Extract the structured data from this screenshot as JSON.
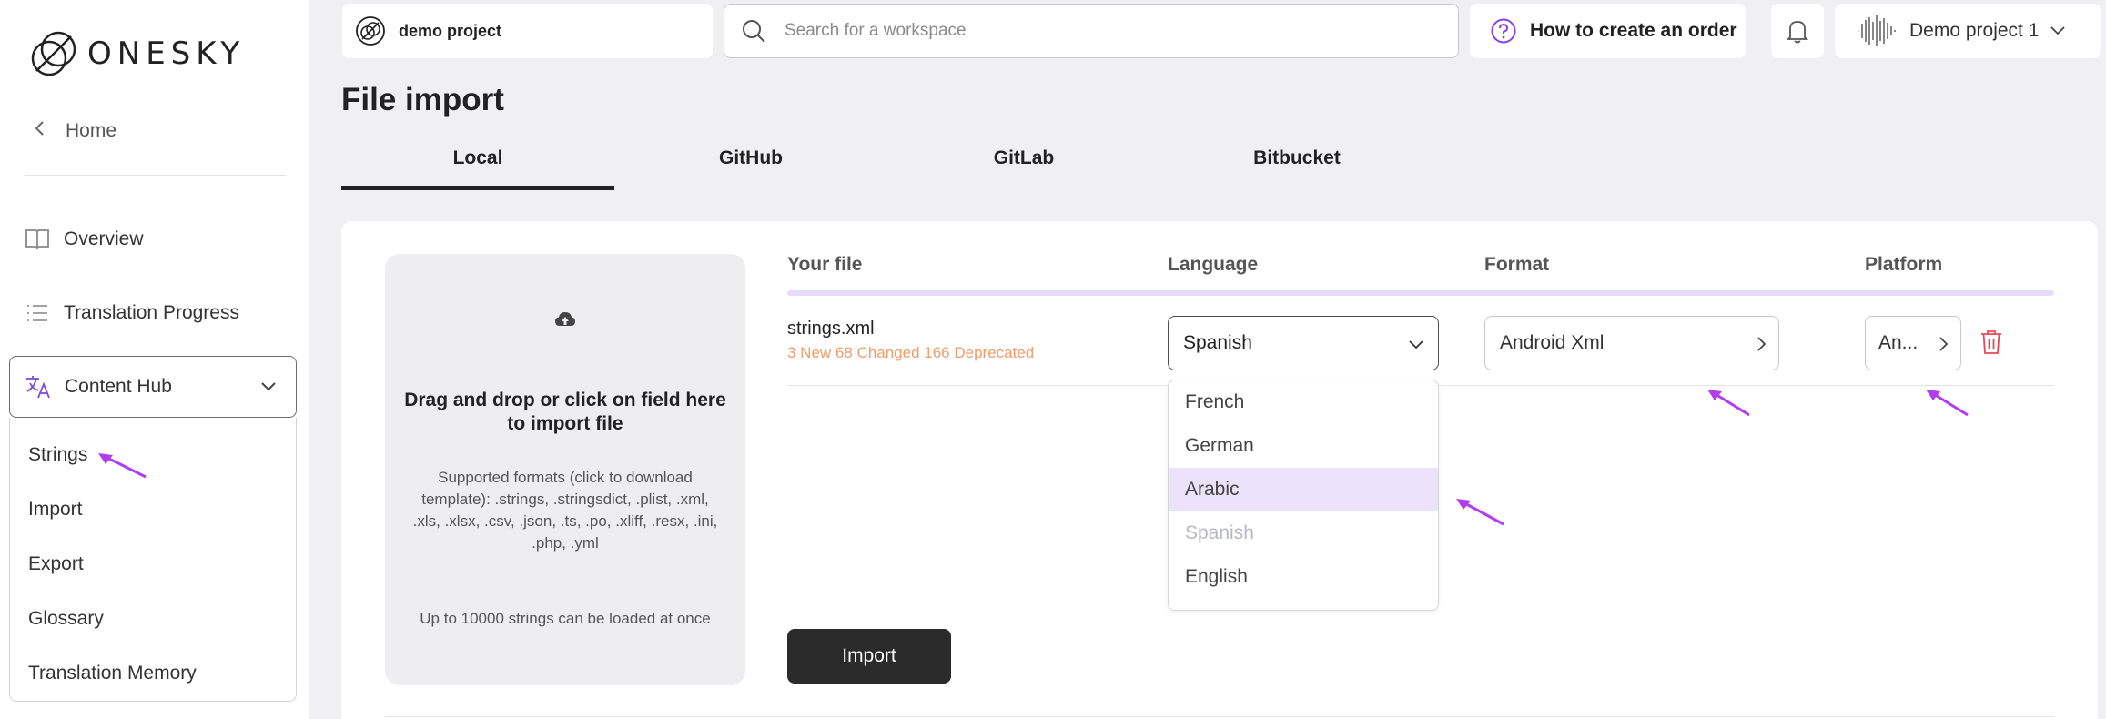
{
  "brand": {
    "name": "ONESKY",
    "accent": "#b13cf0"
  },
  "sidebar": {
    "home_label": "Home",
    "nav": [
      {
        "label": "Overview",
        "icon": "book-icon"
      },
      {
        "label": "Translation Progress",
        "icon": "list-icon"
      }
    ],
    "content_hub": {
      "label": "Content Hub",
      "icon": "translate-icon",
      "expanded": true
    },
    "sub_items": [
      "Strings",
      "Import",
      "Export",
      "Glossary",
      "Translation Memory"
    ]
  },
  "topbar": {
    "project_name": "demo project",
    "search_placeholder": "Search for a workspace",
    "help_label": "How to create an order",
    "account_name": "Demo project 1"
  },
  "page": {
    "title": "File import",
    "tabs": [
      "Local",
      "GitHub",
      "GitLab",
      "Bitbucket"
    ],
    "active_tab": "Local"
  },
  "dropzone": {
    "title": "Drag and drop or click on field here to import file",
    "formats_text": "Supported formats (click to download template): .strings, .stringsdict, .plist, .xml, .xls, .xlsx, .csv, .json, .ts, .po, .xliff, .resx, .ini, .php, .yml",
    "limit_text": "Up to 10000 strings can be loaded at once"
  },
  "table": {
    "headers": {
      "file": "Your file",
      "language": "Language",
      "format": "Format",
      "platform": "Platform"
    },
    "row": {
      "file_name": "strings.xml",
      "stats": "3 New 68 Changed 166 Deprecated",
      "language": "Spanish",
      "format": "Android Xml",
      "platform": "An..."
    }
  },
  "language_dropdown": {
    "options": [
      "French",
      "German",
      "Arabic",
      "Spanish",
      "English"
    ],
    "highlighted": "Arabic",
    "disabled": "Spanish"
  },
  "import_button": "Import"
}
